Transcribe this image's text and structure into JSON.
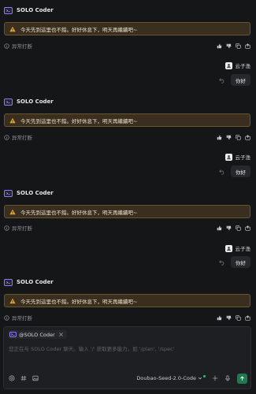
{
  "agent": {
    "name": "SOLO Coder"
  },
  "warning": {
    "text": "今天先到這里也不錯。好好休息下，明天再繼續吧~"
  },
  "meta": {
    "status": "异常打断"
  },
  "user": {
    "name": "云子渔",
    "message": "你好"
  },
  "composer": {
    "mention": "@SOLO Coder",
    "placeholder": "您正在与 SOLO Coder 聊天。输入 '/' 获取更多能力，如 '/plan', '/spec'",
    "model": "Doubao-Seed-2.0-Code"
  },
  "colors": {
    "background": "#151618",
    "warning_bg": "#3a2f1e",
    "warning_border": "#6b5530",
    "warning_icon": "#e0a63b",
    "send_button": "#1f7a4d",
    "status_dot": "#2fbf71",
    "agent_logo": "#8b7cff"
  },
  "icons": {
    "agent": "solo-logo-icon",
    "warning": "warning-triangle-icon",
    "status": "info-icon",
    "feedback": [
      "thumbs-up-icon",
      "thumbs-down-icon",
      "copy-icon",
      "share-icon"
    ],
    "undo": "undo-icon",
    "composer_tools": [
      "mention-icon",
      "hash-icon",
      "image-icon"
    ],
    "composer_right": [
      "add-icon",
      "mic-icon",
      "send-icon"
    ]
  }
}
